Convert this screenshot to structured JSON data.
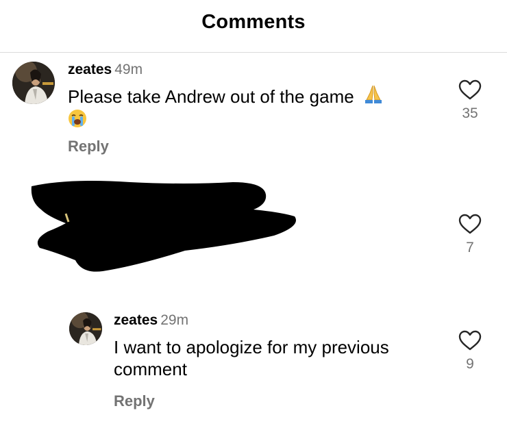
{
  "header": {
    "title": "Comments"
  },
  "comments": [
    {
      "username": "zeates",
      "time": "49m",
      "text": "Please take Andrew out of the game",
      "emojis": [
        "folded-hands",
        "loudly-crying-face"
      ],
      "likes": "35",
      "reply_label": "Reply"
    },
    {
      "redacted": true,
      "likes": "7"
    },
    {
      "username": "zeates",
      "time": "29m",
      "text_line1": "I want to apologize for my previous",
      "text_line2": "comment",
      "likes": "9",
      "reply_label": "Reply",
      "is_reply": true
    }
  ],
  "colors": {
    "secondary_text": "#737373",
    "divider": "#dbdbdb",
    "redaction": "#000000"
  },
  "icons": [
    "heart-outline-icon",
    "folded-hands-emoji",
    "loudly-crying-face-emoji"
  ]
}
